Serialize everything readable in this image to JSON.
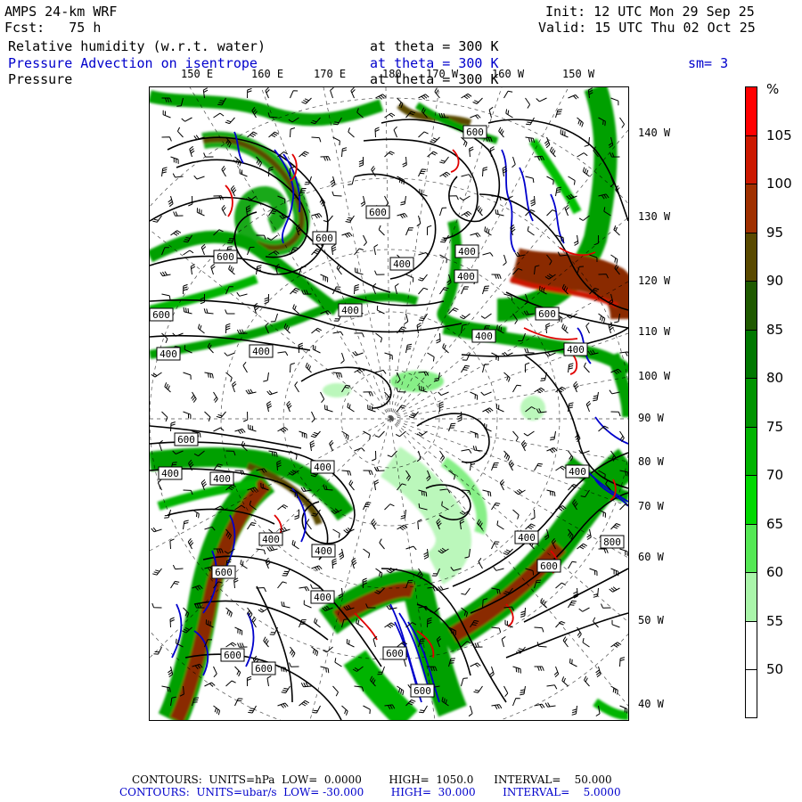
{
  "header": {
    "model": "AMPS 24-km WRF",
    "forecast": "Fcst:   75 h",
    "init": "Init: 12 UTC Mon 29 Sep 25",
    "valid": "Valid: 15 UTC Thu 02 Oct 25",
    "field1": "Relative humidity (w.r.t. water)",
    "field1_level": "at theta = 300 K",
    "field2": "Pressure Advection on isentrope",
    "field2_level": "at theta = 300 K",
    "smoothing": "sm= 3",
    "field3": "Pressure",
    "field3_level": "at theta = 300 K"
  },
  "lon_top": [
    "150 E",
    "160 E",
    "170 E",
    "180",
    "170 W",
    "160 W",
    "150 W"
  ],
  "lon_right": [
    "140 W",
    "130 W",
    "120 W",
    "110 W",
    "100 W",
    "90 W",
    "80 W",
    "70 W",
    "60 W",
    "50 W",
    "40 W"
  ],
  "contour_labels": [
    "600",
    "600",
    "600",
    "600",
    "400",
    "400",
    "400",
    "400",
    "600",
    "400",
    "400",
    "400",
    "600",
    "400",
    "600",
    "400",
    "400",
    "400",
    "400",
    "400",
    "400",
    "400",
    "400",
    "800",
    "600",
    "600",
    "600",
    "600",
    "600",
    "600"
  ],
  "colorbar": {
    "unit": "%",
    "labels": [
      "105",
      "100",
      "95",
      "90",
      "85",
      "80",
      "75",
      "70",
      "65",
      "60",
      "55",
      "50"
    ],
    "colors": [
      "#ff0000",
      "#cc1800",
      "#a03000",
      "#5a4a00",
      "#1f5a00",
      "#007800",
      "#009400",
      "#00b400",
      "#00d800",
      "#55e855",
      "#aaf5aa",
      "#ffffff",
      "#ffffff"
    ]
  },
  "footer": {
    "line1": "CONTOURS:  UNITS=hPa  LOW=  0.0000        HIGH=  1050.0      INTERVAL=    50.000",
    "line2": "CONTOURS:  UNITS=ubar/s  LOW= -30.000        HIGH=  30.000        INTERVAL=    5.0000"
  }
}
